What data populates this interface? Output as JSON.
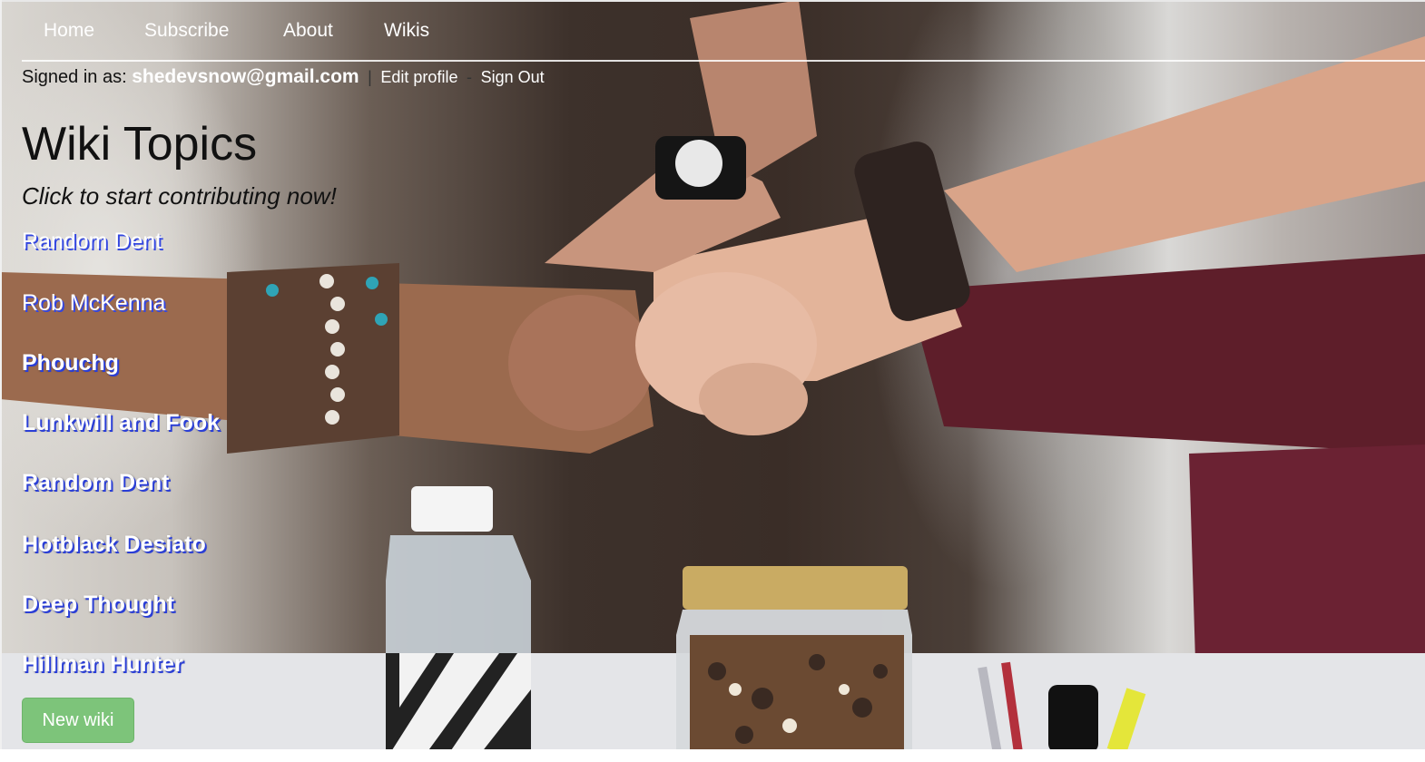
{
  "nav": {
    "items": [
      {
        "label": "Home"
      },
      {
        "label": "Subscribe"
      },
      {
        "label": "About"
      },
      {
        "label": "Wikis"
      }
    ]
  },
  "session": {
    "signed_in_prefix": "Signed in as:",
    "email": "shedevsnow@gmail.com",
    "separator_1": "|",
    "edit_profile": "Edit profile",
    "separator_2": "-",
    "sign_out": "Sign Out"
  },
  "main": {
    "title": "Wiki Topics",
    "subtitle": "Click to start contributing now!",
    "topics": [
      {
        "label": "Random Dent"
      },
      {
        "label": "Rob McKenna"
      },
      {
        "label": "Phouchg"
      },
      {
        "label": "Lunkwill and Fook"
      },
      {
        "label": "Random Dent"
      },
      {
        "label": "Hotblack Desiato"
      },
      {
        "label": "Deep Thought"
      },
      {
        "label": "Hillman Hunter"
      }
    ],
    "new_wiki_label": "New wiki"
  },
  "colors": {
    "button": "#7dc47a",
    "link_text": "#ffffff",
    "link_shadow": "#2a3ed6",
    "heading": "#111111"
  },
  "background": {
    "icon": "team-fist-bump-photo"
  }
}
